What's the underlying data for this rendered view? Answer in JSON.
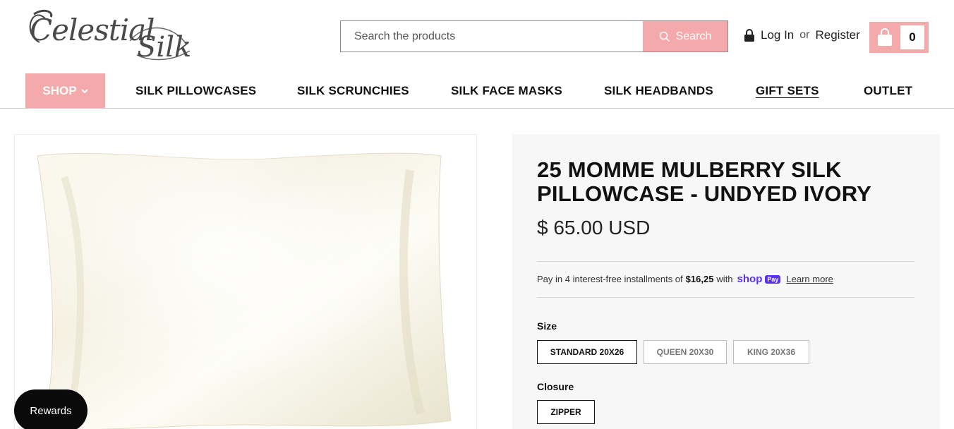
{
  "brand": {
    "line1": "Celestial",
    "line2": "Silk"
  },
  "search": {
    "placeholder": "Search the products",
    "button_label": "Search"
  },
  "account": {
    "login": "Log In",
    "or": "or",
    "register": "Register"
  },
  "cart": {
    "count": "0"
  },
  "nav": {
    "shop": "SHOP",
    "items": [
      "SILK PILLOWCASES",
      "SILK SCRUNCHIES",
      "SILK FACE MASKS",
      "SILK HEADBANDS",
      "GIFT SETS",
      "OUTLET"
    ]
  },
  "product": {
    "title": "25 MOMME MULBERRY SILK PILLOWCASE - UNDYED IVORY",
    "price": "$ 65.00 USD",
    "installments": {
      "prefix": "Pay in 4 interest-free installments of",
      "amount": "$16,25",
      "with": "with",
      "shop_word": "shop",
      "pay_badge": "Pay",
      "learn_more": "Learn more"
    },
    "size": {
      "label": "Size",
      "options": [
        "STANDARD 20X26",
        "QUEEN 20X30",
        "KING 20X36"
      ],
      "selected": "STANDARD 20X26"
    },
    "closure": {
      "label": "Closure",
      "options": [
        "ZIPPER"
      ],
      "selected": "ZIPPER"
    }
  },
  "rewards": {
    "label": "Rewards"
  },
  "colors": {
    "accent_pink": "#f4a9aa",
    "shop_pay_purple": "#5a31f4",
    "panel_bg": "#f7f7f7"
  }
}
